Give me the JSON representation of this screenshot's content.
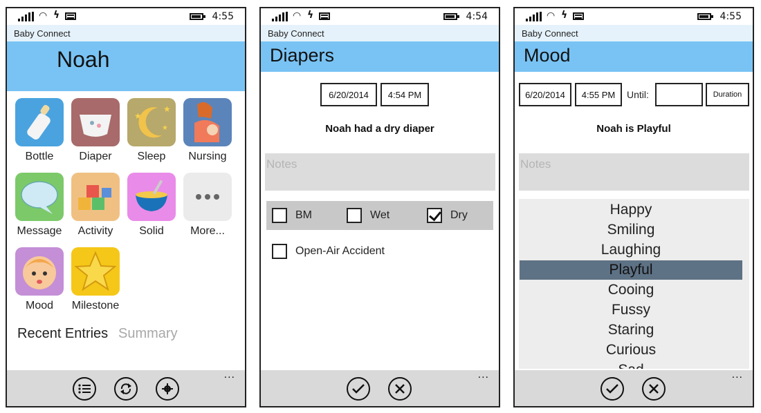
{
  "statusbar": [
    {
      "time": "4:55"
    },
    {
      "time": "4:54"
    },
    {
      "time": "4:55"
    }
  ],
  "app_title": "Baby Connect",
  "home": {
    "child_name": "Noah",
    "tiles": [
      {
        "label": "Bottle",
        "icon": "bottle-icon"
      },
      {
        "label": "Diaper",
        "icon": "diaper-icon"
      },
      {
        "label": "Sleep",
        "icon": "sleep-moon-icon"
      },
      {
        "label": "Nursing",
        "icon": "nursing-icon"
      },
      {
        "label": "Message",
        "icon": "speech-bubble-icon"
      },
      {
        "label": "Activity",
        "icon": "blocks-icon"
      },
      {
        "label": "Solid",
        "icon": "food-bowl-icon"
      },
      {
        "label": "More...",
        "icon": "more-dots-icon"
      },
      {
        "label": "Mood",
        "icon": "baby-face-icon"
      },
      {
        "label": "Milestone",
        "icon": "star-icon"
      }
    ],
    "tabs": [
      "Recent Entries",
      "Summary"
    ],
    "appbar": {
      "icons": [
        "list-icon",
        "sync-icon",
        "settings-icon"
      ],
      "more": "..."
    }
  },
  "diapers": {
    "title": "Diapers",
    "date": "6/20/2014",
    "time": "4:54 PM",
    "summary": "Noah had a dry diaper",
    "notes_placeholder": "Notes",
    "options": [
      {
        "label": "BM",
        "checked": false
      },
      {
        "label": "Wet",
        "checked": false
      },
      {
        "label": "Dry",
        "checked": true
      }
    ],
    "accident_label": "Open-Air Accident",
    "accident_checked": false,
    "appbar": {
      "icons": [
        "check-icon",
        "close-icon"
      ],
      "more": "..."
    }
  },
  "mood": {
    "title": "Mood",
    "date": "6/20/2014",
    "time": "4:55 PM",
    "until_label": "Until:",
    "until_value": "",
    "duration_label": "Duration",
    "summary": "Noah is Playful",
    "notes_placeholder": "Notes",
    "moods": [
      "Happy",
      "Smiling",
      "Laughing",
      "Playful",
      "Cooing",
      "Fussy",
      "Staring",
      "Curious",
      "Sad"
    ],
    "selected": "Playful",
    "appbar": {
      "icons": [
        "check-icon",
        "close-icon"
      ],
      "more": "..."
    }
  },
  "colors": {
    "header_blue": "#79c3f4",
    "title_strip": "#e5f2fb",
    "appbar_gray": "#d9d9d9",
    "selected_mood": "#5e7285",
    "summary_inactive": "#a8a8a8"
  }
}
